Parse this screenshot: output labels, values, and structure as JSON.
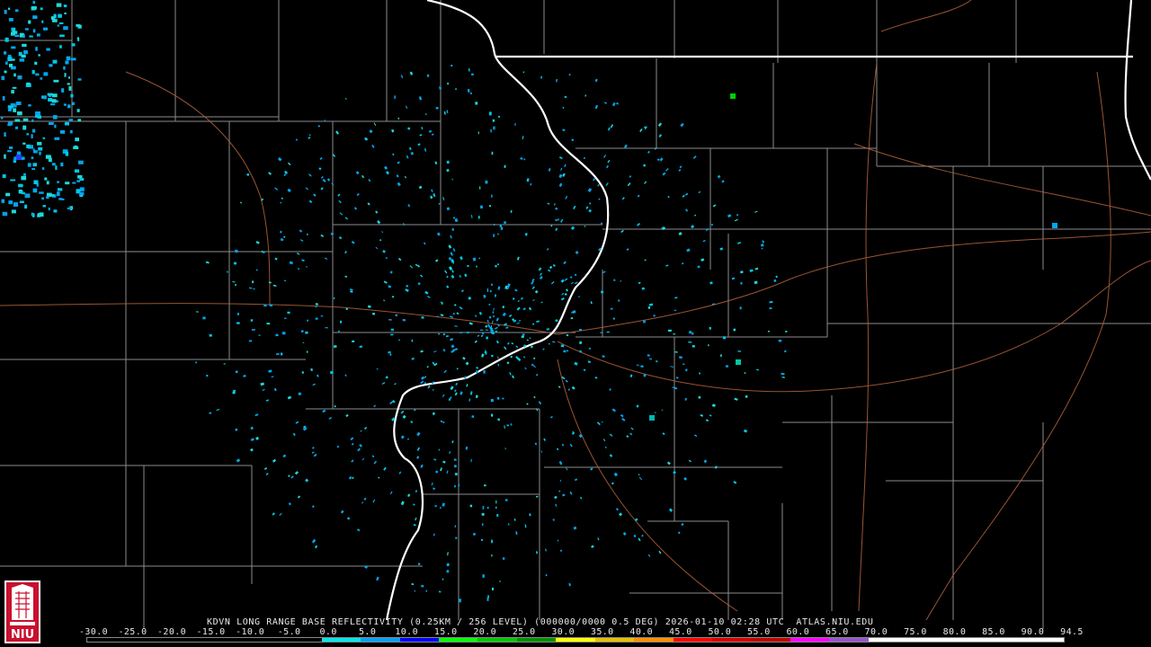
{
  "caption": "KDVN LONG RANGE BASE REFLECTIVITY (0.25KM / 256 LEVEL) (000000/0000 0.5 DEG) 2026-01-10 02:28 UTC  ATLAS.NIU.EDU",
  "logo": {
    "text": "NIU",
    "color": "#c8102e"
  },
  "scale": {
    "labels": [
      "-30.0",
      "-25.0",
      "-20.0",
      "-15.0",
      "-10.0",
      "-5.0",
      "0.0",
      "5.0",
      "10.0",
      "15.0",
      "20.0",
      "25.0",
      "30.0",
      "35.0",
      "40.0",
      "45.0",
      "50.0",
      "55.0",
      "60.0",
      "65.0",
      "70.0",
      "75.0",
      "80.0",
      "85.0",
      "90.0",
      "94.5"
    ],
    "colors": [
      "#000000",
      "#000000",
      "#000000",
      "#000000",
      "#000000",
      "#000000",
      "#00e8e8",
      "#00a0f6",
      "#0000f6",
      "#00ff00",
      "#00c800",
      "#009000",
      "#ffff00",
      "#e7c000",
      "#ff9000",
      "#ff0000",
      "#d60000",
      "#c00000",
      "#ff00ff",
      "#9955c9",
      "#ffffff",
      "#ffffff",
      "#ffffff",
      "#ffffff",
      "#ffffff"
    ]
  }
}
